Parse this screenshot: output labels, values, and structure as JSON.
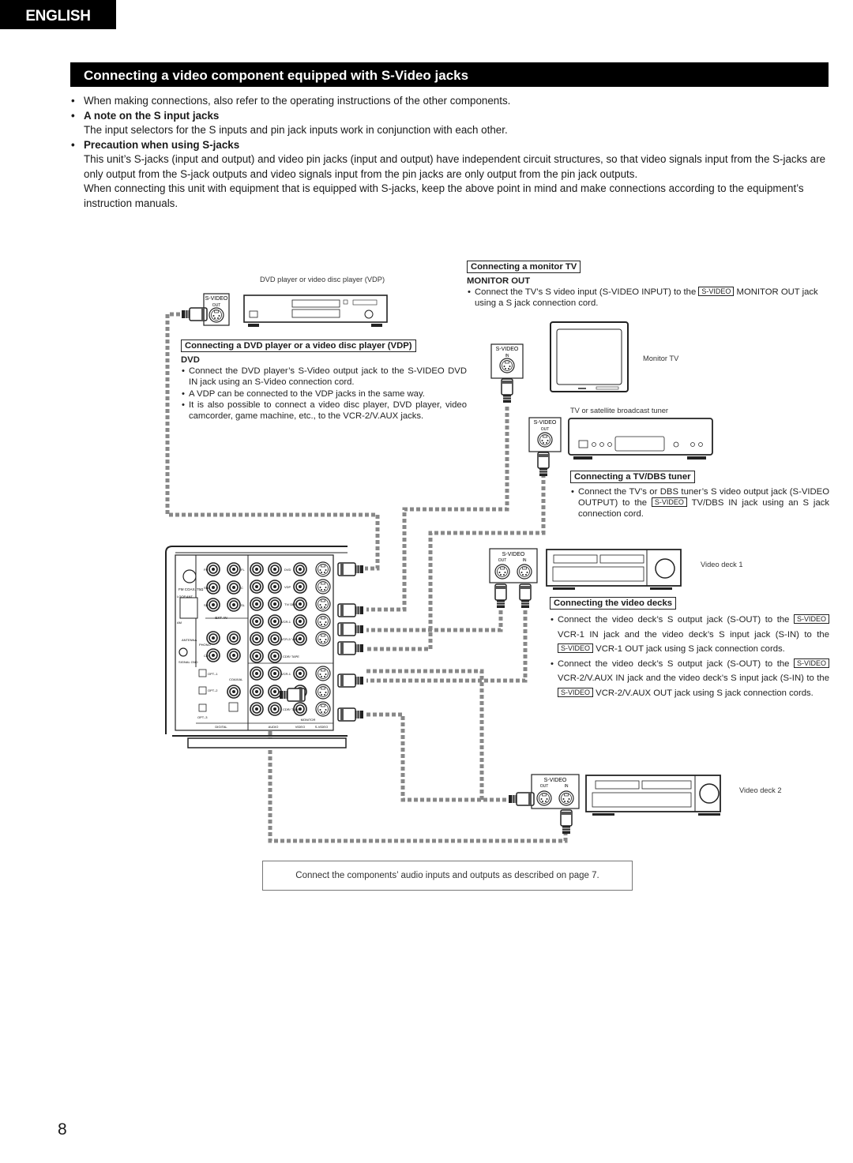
{
  "language_tab": "ENGLISH",
  "section_title": "Connecting a video component equipped with S-Video jacks",
  "intro": {
    "bullet_1": "When making connections, also refer to the operating instructions of the other components.",
    "note_heading": "A note on the S input jacks",
    "note_text": "The input selectors for the S inputs and pin jack inputs work in conjunction with each other.",
    "precaution_heading": "Precaution when using S-jacks",
    "precaution_text_1": "This unit’s S-jacks (input and output) and video pin jacks (input and output) have independent circuit structures, so that video signals input  from the S-jacks are only output from the S-jack outputs and video signals input from the pin jacks are only output from the pin jack outputs.",
    "precaution_text_2": "When connecting this unit with equipment that is equipped with S-jacks, keep the above point in mind and make connections according to the equipment’s instruction manuals."
  },
  "devices": {
    "dvd_caption": "DVD player or video disc player (VDP)",
    "monitor_caption": "Monitor TV",
    "tuner_caption": "TV or satellite broadcast tuner",
    "deck1_caption": "Video deck 1",
    "deck2_caption": "Video deck 2",
    "jack_svideo": "S-VIDEO",
    "jack_out": "OUT",
    "jack_in": "IN"
  },
  "dvd_section": {
    "heading": "Connecting a DVD player or a video disc player (VDP)",
    "subheading": "DVD",
    "bullets": [
      "Connect the DVD player’s S-Video output jack to the S-VIDEO DVD IN jack using an S-Video connection cord.",
      "A VDP can be connected to the VDP jacks in the same way.",
      "It is also possible to connect a video disc player, DVD player, video camcorder, game machine, etc., to the VCR-2/V.AUX jacks."
    ]
  },
  "monitor_section": {
    "heading": "Connecting a monitor TV",
    "subheading": "MONITOR OUT",
    "bullet_pre": "Connect the TV’s S video input (S-VIDEO INPUT) to the",
    "tag": "S-VIDEO",
    "bullet_post": "MONITOR OUT jack using a S jack connection cord."
  },
  "tuner_section": {
    "heading": "Connecting a TV/DBS tuner",
    "bullet_pre": "Connect the TV’s or DBS tuner’s S video output jack (S-VIDEO OUTPUT) to the",
    "tag": "S-VIDEO",
    "bullet_post": "TV/DBS IN jack using an S jack connection cord."
  },
  "deck_section": {
    "heading": "Connecting the video decks",
    "b1_pre": "Connect the video deck’s S output jack (S-OUT) to the",
    "b1_mid": "VCR-1 IN jack and the video deck’s S input jack (S-IN) to the",
    "b1_post": "VCR-1 OUT jack using S jack connection cords.",
    "b2_pre": "Connect the video deck’s S output jack (S-OUT) to the",
    "b2_mid": "VCR-2/V.AUX IN jack and the video deck’s S input jack (S-IN) to the",
    "b2_post": "VCR-2/V.AUX OUT jack using S jack connection cords.",
    "tag": "S-VIDEO"
  },
  "receiver_panel": {
    "labels": {
      "fm": "FM COAX. 75Ω",
      "loop": "LOOP ANT.",
      "am": "AM",
      "antenna": "ANTENNA",
      "phono": "PHONO",
      "signal_gnd": "SIGNAL GND",
      "ext_in": "EXT. IN",
      "fr": "FR",
      "fl": "FL",
      "sw": "SW",
      "c": "C",
      "sr": "SR",
      "sl": "SL",
      "r": "R",
      "l": "L",
      "in": "IN",
      "out": "OUT",
      "dvd": "DVD",
      "vdp": "VDP",
      "tvdbs": "TV/ DBS",
      "vcr1": "VCR-1",
      "vcr2": "VCR-2/ V.AUX",
      "cdr": "CDR/ TAPE",
      "cd": "CD",
      "opt1": "OPT.-1",
      "opt2": "OPT.-2",
      "opt3": "OPT.-3",
      "coaxial": "COAXIAL",
      "digital": "DIGITAL",
      "audio": "AUDIO",
      "video": "VIDEO",
      "svideo": "S-VIDEO",
      "monitor": "MONITOR"
    }
  },
  "audio_note": "Connect the components’ audio inputs and outputs as described on page 7.",
  "page_number": "8"
}
